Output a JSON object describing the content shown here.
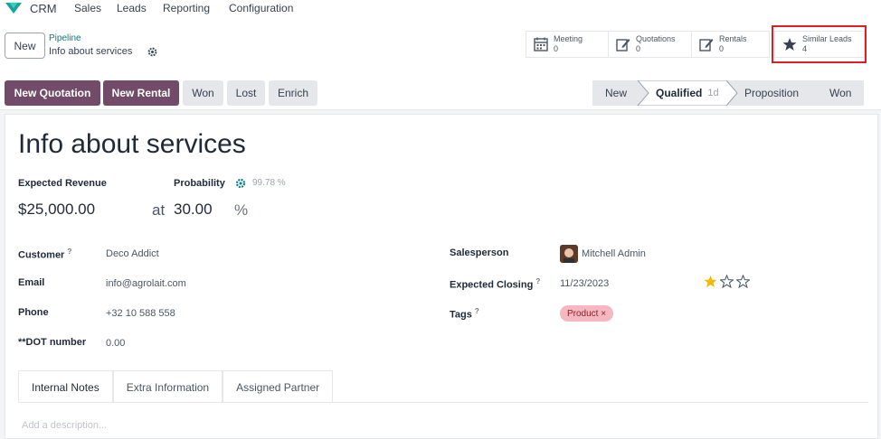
{
  "topnav": {
    "brand": "CRM",
    "menu": [
      "Sales",
      "Leads",
      "Reporting",
      "Configuration"
    ]
  },
  "controlpanel": {
    "new_label": "New",
    "breadcrumb_parent": "Pipeline",
    "breadcrumb_current": "Info about services"
  },
  "stat_buttons": [
    {
      "label": "Meeting",
      "value": "0",
      "icon": "calendar-icon"
    },
    {
      "label": "Quotations",
      "value": "0",
      "icon": "edit-icon"
    },
    {
      "label": "Rentals",
      "value": "0",
      "icon": "edit-icon"
    },
    {
      "label": "Similar Leads",
      "value": "4",
      "icon": "star-icon"
    }
  ],
  "actions": {
    "new_quotation": "New Quotation",
    "new_rental": "New Rental",
    "won": "Won",
    "lost": "Lost",
    "enrich": "Enrich"
  },
  "stages": {
    "new": "New",
    "qualified": "Qualified",
    "qualified_duration": "1d",
    "proposition": "Proposition",
    "won": "Won"
  },
  "form": {
    "title": "Info about services",
    "expected_revenue_label": "Expected Revenue",
    "expected_revenue": "$25,000.00",
    "probability_label": "Probability",
    "probability_hint": "99.78 %",
    "at": "at",
    "probability": "30.00",
    "percent": "%",
    "customer_label": "Customer",
    "customer": "Deco Addict",
    "email_label": "Email",
    "email": "info@agrolait.com",
    "phone_label": "Phone",
    "phone": "+32 10 588 558",
    "dot_label": "**DOT number",
    "dot": "0.00",
    "salesperson_label": "Salesperson",
    "salesperson": "Mitchell Admin",
    "closing_label": "Expected Closing",
    "closing": "11/23/2023",
    "tags_label": "Tags",
    "tag": "Product ×",
    "priority_stars": 1,
    "priority_max": 3,
    "help_mark": "?"
  },
  "tabs": [
    "Internal Notes",
    "Extra Information",
    "Assigned Partner"
  ],
  "description_placeholder": "Add a description...",
  "colors": {
    "brand_purple": "#714b67",
    "teal": "#017e84",
    "highlight_red": "#e11d2a",
    "star_gold": "#f3b805",
    "tag_pink": "#f6b8c0"
  }
}
